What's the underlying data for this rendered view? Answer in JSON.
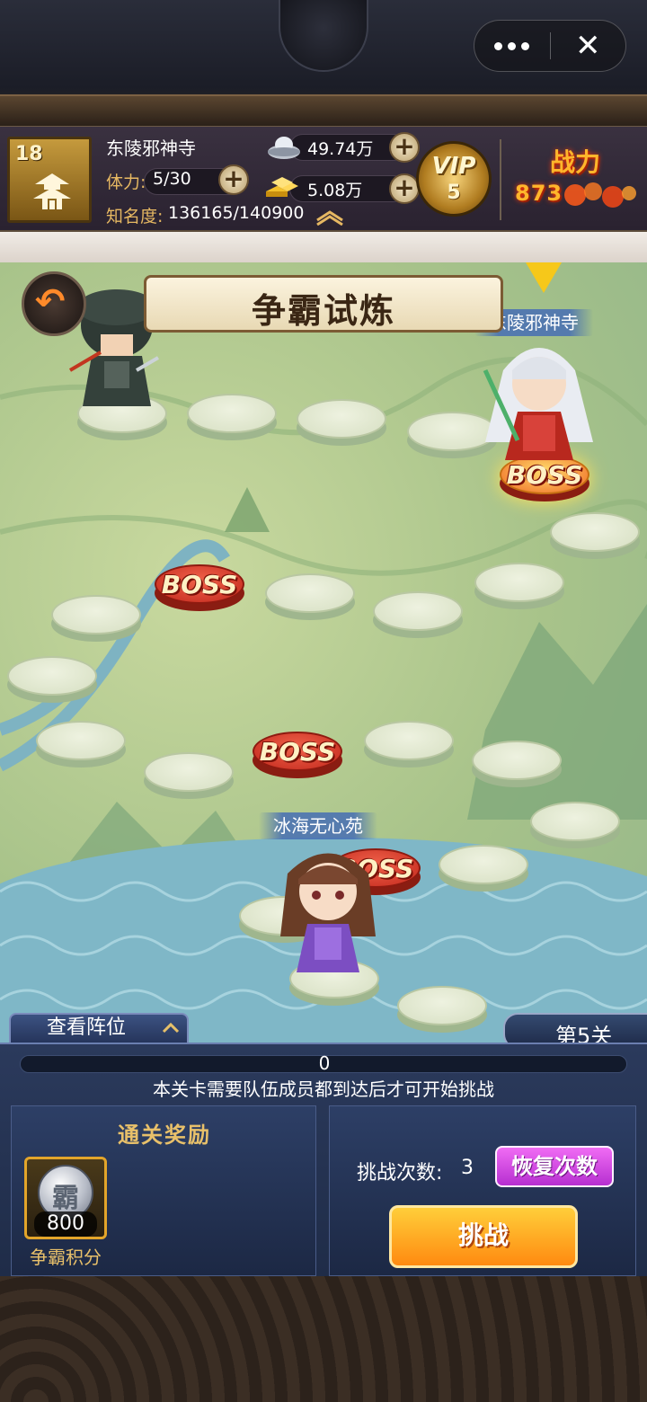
{
  "topbar": {
    "more_icon": "more-dots-icon",
    "close_icon": "close-icon",
    "close_glyph": "✕"
  },
  "status": {
    "level": "18",
    "server_name": "东陵邪神寺",
    "stamina_label": "体力:",
    "stamina_value": "5/30",
    "fame_label": "知名度:",
    "fame_value": "136165/140900",
    "silver_value": "49.74万",
    "gold_value": "5.08万",
    "plus_glyph": "+",
    "vip_label": "VIP",
    "vip_level": "5",
    "power_label": "战力",
    "power_value": "873"
  },
  "map": {
    "title": "争霸试炼",
    "top_left_tag": "",
    "player_tag_top": "东陵邪神寺",
    "player_tag_bottom": "冰海无心苑",
    "boss_label": "BOSS",
    "back_glyph": "↶"
  },
  "bottom": {
    "formation_tab": "查看阵位",
    "stage_tab": "第5关",
    "progress_value": "0",
    "progress_fraction": 0,
    "notice": "本关卡需要队伍成员都到达后才可开始挑战",
    "reward_title": "通关奖励",
    "reward_glyph": "霸",
    "reward_count": "800",
    "reward_name": "争霸积分",
    "attempts_label": "挑战次数:",
    "attempts_value": "3",
    "restore_button": "恢复次数",
    "challenge_button": "挑战"
  },
  "colors": {
    "accent_gold": "#e8c06a",
    "challenge_orange": "#ff8a10",
    "restore_purple": "#b62fd0",
    "boss_red": "#c2281c"
  }
}
